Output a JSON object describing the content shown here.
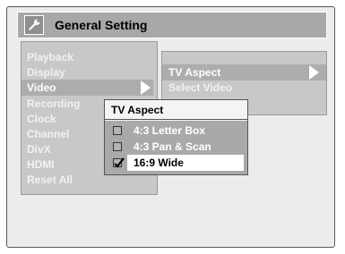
{
  "title": "General Setting",
  "title_icon": "wrench-icon",
  "main_menu": {
    "items": [
      "Playback",
      "Display",
      "Video",
      "Recording",
      "Clock",
      "Channel",
      "DivX",
      "HDMI",
      "Reset All"
    ],
    "selected_index": 2
  },
  "sub_menu": {
    "items": [
      "TV Aspect",
      "Select Video"
    ],
    "selected_index": 0
  },
  "popup": {
    "title": "TV Aspect",
    "options": [
      {
        "label": "4:3 Letter Box",
        "checked": false
      },
      {
        "label": "4:3 Pan & Scan",
        "checked": false
      },
      {
        "label": "16:9 Wide",
        "checked": true
      }
    ],
    "selected_index": 2
  }
}
